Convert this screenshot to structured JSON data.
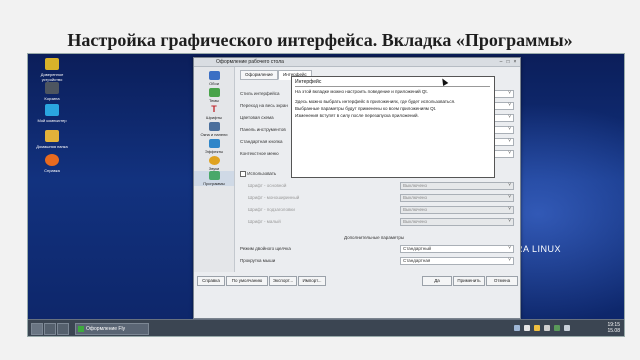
{
  "title": "Настройка графического интерфейса. Вкладка «Программы»",
  "desktop": {
    "icons": [
      {
        "label": "Доверенное устройство"
      },
      {
        "label": "Корзина"
      },
      {
        "label": "Мой компьютер"
      },
      {
        "label": "Домашняя папка"
      },
      {
        "label": "Справка"
      }
    ],
    "brand": "RA LINUX"
  },
  "window": {
    "title": "Оформление рабочего стола",
    "sidebar": [
      {
        "label": "Обои"
      },
      {
        "label": "Темы"
      },
      {
        "label": "Шрифты"
      },
      {
        "label": "Окна и панели"
      },
      {
        "label": "Эффекты"
      },
      {
        "label": "Звуки"
      },
      {
        "label": "Программы"
      }
    ],
    "tabs": [
      {
        "label": "Оформление"
      },
      {
        "label": "Интерфейс"
      }
    ],
    "tooltip": {
      "title": "Интерфейс",
      "header": "На этой вкладке можно настроить поведение и приложений Qt.",
      "para1": "Здесь можно выбрать интерфейс в приложениях, где будет использоваться.",
      "para2": "Выбранные параметры будут применены ко всем приложениям Qt.",
      "para3": "Изменения вступят в силу после перезапуска приложений."
    },
    "rows": [
      {
        "label": "Стиль интерфейса"
      },
      {
        "label": "Переход на весь экран"
      },
      {
        "label": "Цветовая схема"
      },
      {
        "label": "Панель инструментов"
      },
      {
        "label": "Стандартная кнопка"
      },
      {
        "label": "Контекстное меню"
      }
    ],
    "disabled_section": {
      "checkbox": "Использовать",
      "rows": [
        {
          "label": "Шрифт - основной",
          "value": "Выключено"
        },
        {
          "label": "Шрифт - моноширинный",
          "value": "Выключено"
        },
        {
          "label": "Шрифт - подзаголовки",
          "value": "Выключено"
        },
        {
          "label": "Шрифт - малый",
          "value": "Выключено"
        }
      ]
    },
    "section_header": "Дополнительные параметры",
    "extra_rows": [
      {
        "label": "Режим двойного щелчка",
        "value": "Стандартный"
      },
      {
        "label": "Прокрутка мыши",
        "value": "Стандартная"
      }
    ],
    "buttons": {
      "help": "Справка",
      "default": "По умолчанию",
      "export": "Экспорт...",
      "import": "Импорт...",
      "ok": "Да",
      "apply": "Применить",
      "cancel": "Отмена"
    }
  },
  "taskbar": {
    "task": "Оформление Fly",
    "time": "19:15",
    "date": "15.08"
  },
  "colors": {
    "desktop": "#12327f",
    "taskbar": "#3b4552",
    "window": "#ebedf0"
  }
}
